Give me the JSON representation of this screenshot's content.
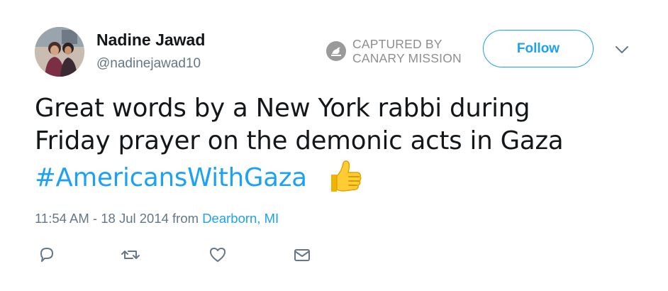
{
  "tweet": {
    "author": {
      "display_name": "Nadine Jawad",
      "handle": "@nadinejawad10"
    },
    "stamp": {
      "line1": "CAPTURED BY",
      "line2": "CANARY MISSION"
    },
    "follow_label": "Follow",
    "text": {
      "line1": "Great words by a New York rabbi during",
      "line2": "Friday prayer on the demonic acts in Gaza",
      "hashtag": "#AmericansWithGaza",
      "emoji": "thumbs-up"
    },
    "meta": {
      "timestamp": "11:54 AM - 18 Jul 2014",
      "from": " from ",
      "location": "Dearborn, MI"
    },
    "actions": [
      "reply-icon",
      "retweet-icon",
      "like-icon",
      "direct-message-icon"
    ]
  },
  "colors": {
    "accent": "#1da1f2",
    "text": "#14171a",
    "secondary": "#657786",
    "stamp_gray": "#8e8e8e"
  }
}
